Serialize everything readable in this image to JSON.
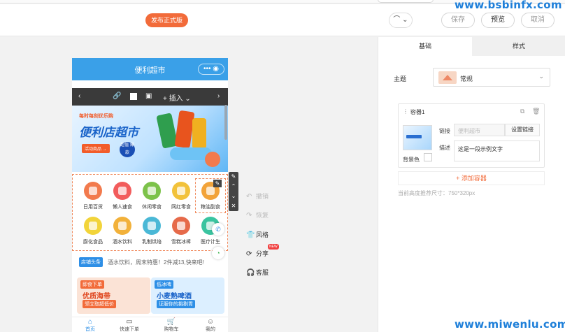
{
  "toolbar": {
    "publish_label": "发布正式版",
    "headset_label": "⌒ ⌄",
    "save_label": "保存",
    "preview_label": "预览",
    "cancel_label": "取消"
  },
  "watermarks": {
    "top": "www.bsbinfx.com",
    "bottom": "www.miwenlu.com"
  },
  "phone": {
    "title": "便利超市",
    "capsule": "••• ◉",
    "rte": {
      "prev": "‹",
      "link": "🔗",
      "image": "▣",
      "insert": "+ 插入 ⌄",
      "next": "›"
    },
    "banner": {
      "small": "每时每刻优乐购",
      "title": "便利店超市",
      "tag": "活动商品 →",
      "badge": "超值 爆款"
    },
    "categories": [
      {
        "label": "日用百货",
        "color": "#f27a4d"
      },
      {
        "label": "懒人速食",
        "color": "#f25c5c"
      },
      {
        "label": "休闲零食",
        "color": "#7cc24a"
      },
      {
        "label": "网红零食",
        "color": "#f2c23a"
      },
      {
        "label": "粮油副食",
        "color": "#f2a33a"
      },
      {
        "label": "膨化食品",
        "color": "#f2d43a"
      },
      {
        "label": "酒水饮料",
        "color": "#f2b13a"
      },
      {
        "label": "乳制烘焙",
        "color": "#4ab8d6"
      },
      {
        "label": "雪糕冰棒",
        "color": "#e66a4a"
      },
      {
        "label": "医疗计生",
        "color": "#3ac4a0"
      }
    ],
    "pen": "✎",
    "notice": {
      "tag": "店铺头条",
      "text": "酒水饮料，周末特惠！2件减13,快来吧!"
    },
    "promos": [
      {
        "tag": "即食下单",
        "title": "优质海带",
        "sub": "领立取超低价"
      },
      {
        "tag": "低冰啤",
        "title": "小麦熟啤酒",
        "sub": "证服你的挑剔胃"
      }
    ],
    "tabs": [
      {
        "icon": "⌂",
        "label": "首页"
      },
      {
        "icon": "▭",
        "label": "快速下单"
      },
      {
        "icon": "🛒",
        "label": "购物车"
      },
      {
        "icon": "☺",
        "label": "我的"
      }
    ],
    "vtools": [
      "✎",
      "⌃",
      "⌄",
      "✕"
    ],
    "float_phone": "✆",
    "float_wechat": "◔"
  },
  "side_actions": [
    {
      "icon": "↶",
      "label": "撤销",
      "enabled": false
    },
    {
      "icon": "↷",
      "label": "恢复",
      "enabled": false
    },
    {
      "icon": "👕",
      "label": "风格",
      "enabled": true
    },
    {
      "icon": "⟳",
      "label": "分享",
      "enabled": true
    },
    {
      "icon": "🎧",
      "label": "客服",
      "enabled": true
    }
  ],
  "share_badge": "NEW",
  "panel": {
    "tabs": [
      "基础",
      "样式"
    ],
    "theme_label": "主题",
    "theme_value": "常规",
    "container": {
      "title": "容器1",
      "link_label": "链接",
      "link_value": "便利超市",
      "link_button": "设置链接",
      "desc_label": "描述",
      "desc_value": "这是一段示例文字",
      "bg_label": "背景色"
    },
    "add_button": "+ 添加容器",
    "size_hint": "当前高度推荐尺寸：750*320px"
  }
}
